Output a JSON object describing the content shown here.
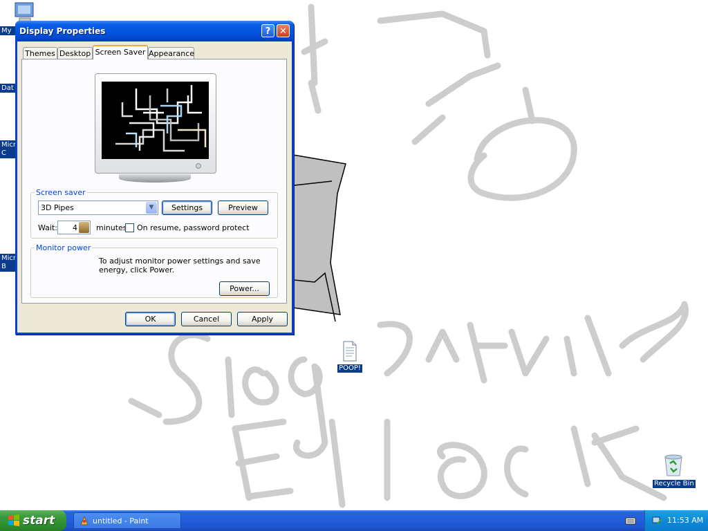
{
  "window": {
    "title": "Display Properties",
    "help_glyph": "?",
    "close_glyph": "✕"
  },
  "tabs": [
    {
      "label": "Themes"
    },
    {
      "label": "Desktop"
    },
    {
      "label": "Screen Saver",
      "active": true
    },
    {
      "label": "Appearance"
    }
  ],
  "screensaver": {
    "group_label": "Screen saver",
    "selected": "3D Pipes",
    "settings_label": "Settings",
    "preview_label": "Preview",
    "wait_label": "Wait:",
    "wait_value": "4",
    "minutes_label": "minutes",
    "password_label": "On resume, password protect",
    "password_checked": false
  },
  "monitor_power": {
    "group_label": "Monitor power",
    "description": "To adjust monitor power settings and save energy, click Power.",
    "power_label": "Power..."
  },
  "dialog_buttons": {
    "ok": "OK",
    "cancel": "Cancel",
    "apply": "Apply"
  },
  "desktop": {
    "left_icons": [
      "My",
      "Dat",
      "Micr C",
      "Micr B"
    ],
    "poop_label": "POOP!",
    "recycle_label": "Recycle Bin"
  },
  "taskbar": {
    "start_label": "start",
    "task_label": "untitled - Paint",
    "clock": "11:53 AM"
  },
  "colors": {
    "xp_blue": "#0842c8",
    "start_green": "#3c9a3c",
    "group_legend": "#0046d5",
    "scribble": "#c8c8c8"
  }
}
